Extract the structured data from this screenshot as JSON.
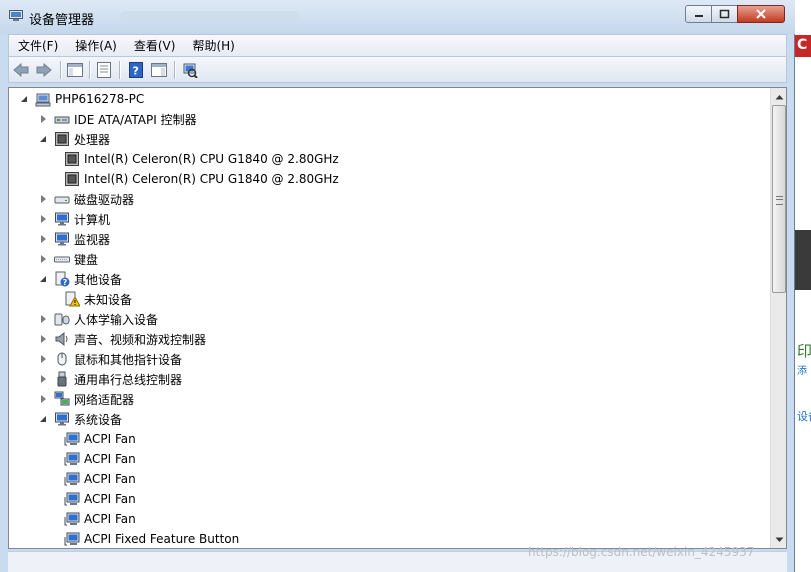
{
  "window": {
    "title": "设备管理器"
  },
  "menu": [
    "文件(F)",
    "操作(A)",
    "查看(V)",
    "帮助(H)"
  ],
  "toolbar": {
    "icons": [
      "back-icon",
      "forward-icon",
      "show-hide-console-tree-icon",
      "properties-icon",
      "help-icon",
      "action-pane-icon",
      "scan-hardware-icon"
    ]
  },
  "tree": {
    "rows": [
      {
        "label": "PHP616278-PC",
        "level": 0,
        "expander": "open",
        "icon": "computer-icon",
        "name": "tree-node-computer"
      },
      {
        "label": "IDE ATA/ATAPI 控制器",
        "level": 1,
        "expander": "col",
        "icon": "ide-controller-icon",
        "name": "tree-node-ide"
      },
      {
        "label": "处理器",
        "level": 1,
        "expander": "open",
        "icon": "cpu-icon",
        "name": "tree-node-processors"
      },
      {
        "label": "Intel(R) Celeron(R) CPU G1840 @ 2.80GHz",
        "level": 2,
        "expander": "none",
        "icon": "cpu-icon",
        "name": "tree-node-cpu-1"
      },
      {
        "label": "Intel(R) Celeron(R) CPU G1840 @ 2.80GHz",
        "level": 2,
        "expander": "none",
        "icon": "cpu-icon",
        "name": "tree-node-cpu-2"
      },
      {
        "label": "磁盘驱动器",
        "level": 1,
        "expander": "col",
        "icon": "disk-drive-icon",
        "name": "tree-node-disk"
      },
      {
        "label": "计算机",
        "level": 1,
        "expander": "col",
        "icon": "monitor-icon",
        "name": "tree-node-computer-class"
      },
      {
        "label": "监视器",
        "level": 1,
        "expander": "col",
        "icon": "monitor-icon",
        "name": "tree-node-monitors"
      },
      {
        "label": "键盘",
        "level": 1,
        "expander": "col",
        "icon": "keyboard-icon",
        "name": "tree-node-keyboard"
      },
      {
        "label": "其他设备",
        "level": 1,
        "expander": "open",
        "icon": "unknown-device-icon",
        "name": "tree-node-other"
      },
      {
        "label": "未知设备",
        "level": 2,
        "expander": "none",
        "icon": "warning-device-icon",
        "name": "tree-node-unknown"
      },
      {
        "label": "人体学输入设备",
        "level": 1,
        "expander": "col",
        "icon": "hid-icon",
        "name": "tree-node-hid"
      },
      {
        "label": "声音、视频和游戏控制器",
        "level": 1,
        "expander": "col",
        "icon": "speaker-icon",
        "name": "tree-node-sound"
      },
      {
        "label": "鼠标和其他指针设备",
        "level": 1,
        "expander": "col",
        "icon": "mouse-icon",
        "name": "tree-node-mouse"
      },
      {
        "label": "通用串行总线控制器",
        "level": 1,
        "expander": "col",
        "icon": "usb-icon",
        "name": "tree-node-usb"
      },
      {
        "label": "网络适配器",
        "level": 1,
        "expander": "col",
        "icon": "network-icon",
        "name": "tree-node-network"
      },
      {
        "label": "系统设备",
        "level": 1,
        "expander": "open",
        "icon": "monitor-icon",
        "name": "tree-node-system"
      },
      {
        "label": "ACPI Fan",
        "level": 2,
        "expander": "none",
        "icon": "system-device-icon",
        "name": "tree-node-acpi-fan-1"
      },
      {
        "label": "ACPI Fan",
        "level": 2,
        "expander": "none",
        "icon": "system-device-icon",
        "name": "tree-node-acpi-fan-2"
      },
      {
        "label": "ACPI Fan",
        "level": 2,
        "expander": "none",
        "icon": "system-device-icon",
        "name": "tree-node-acpi-fan-3"
      },
      {
        "label": "ACPI Fan",
        "level": 2,
        "expander": "none",
        "icon": "system-device-icon",
        "name": "tree-node-acpi-fan-4"
      },
      {
        "label": "ACPI Fan",
        "level": 2,
        "expander": "none",
        "icon": "system-device-icon",
        "name": "tree-node-acpi-fan-5"
      },
      {
        "label": "ACPI Fixed Feature Button",
        "level": 2,
        "expander": "none",
        "icon": "system-device-icon",
        "name": "tree-node-acpi-button"
      }
    ]
  },
  "background": {
    "letter": "C",
    "char1": "印",
    "char2": "添",
    "char3": "设备"
  },
  "watermark": "https://blog.csdn.net/weixin_4245937"
}
